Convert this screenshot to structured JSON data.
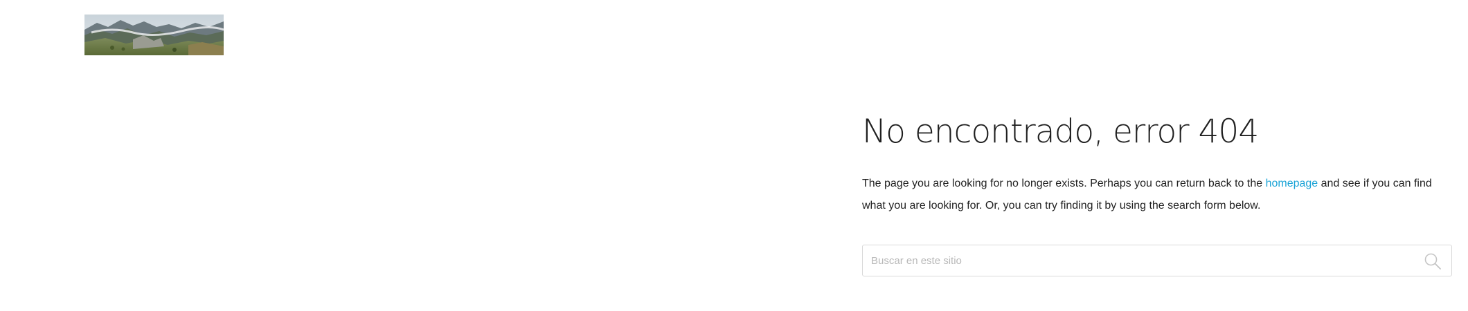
{
  "header": {
    "logo_alt": "mountain-landscape-logo"
  },
  "main": {
    "title": "No encontrado, error 404",
    "message_before": "The page you are looking for no longer exists. Perhaps you can return back to the ",
    "homepage_link": "homepage",
    "message_after": " and see if you can find what you are looking for. Or, you can try finding it by using the search form below."
  },
  "search": {
    "placeholder": "Buscar en este sitio",
    "value": "",
    "icon": "search-icon"
  },
  "colors": {
    "link": "#1aa3d6",
    "text": "#1c1c1c",
    "border": "#d9d9d9",
    "placeholder": "#b8b8b8"
  }
}
